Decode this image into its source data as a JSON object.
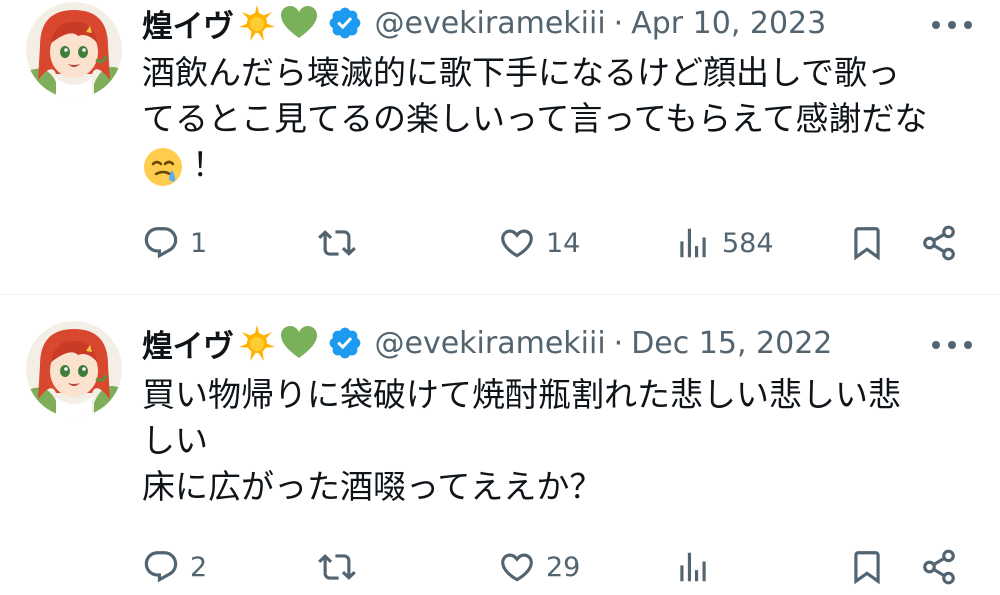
{
  "tweets": [
    {
      "display_name": "煌イヴ",
      "handle": "@evekiramekiii",
      "separator": "·",
      "date": "Apr 10, 2023",
      "text_lines": [
        "酒飲んだら壊滅的に歌下手になるけど顔出しで歌っ",
        "てるとこ見てるの楽しいって言ってもらえて感謝だな",
        "！"
      ],
      "inline_emoji": "face-holding-back-tears",
      "stats": {
        "replies": "1",
        "retweets": "",
        "likes": "14",
        "views": "584"
      }
    },
    {
      "display_name": "煌イヴ",
      "handle": "@evekiramekiii",
      "separator": "·",
      "date": "Dec 15, 2022",
      "text_lines": [
        "買い物帰りに袋破けて焼酎瓶割れた悲しい悲しい悲",
        "しい",
        "床に広がった酒啜ってええか？"
      ],
      "stats": {
        "replies": "2",
        "retweets": "",
        "likes": "29",
        "views": ""
      }
    }
  ],
  "icons": {
    "name_emojis": [
      "glowing-star-emoji",
      "green-heart-emoji"
    ],
    "verified": "verified-badge-icon",
    "more": "more-options-icon",
    "actions": [
      "reply-icon",
      "retweet-icon",
      "like-icon",
      "views-icon",
      "bookmark-icon",
      "share-icon"
    ]
  },
  "colors": {
    "text_primary": "#0f1419",
    "text_secondary": "#536471",
    "verified_blue": "#1d9bf0",
    "divider": "#eff3f4"
  }
}
